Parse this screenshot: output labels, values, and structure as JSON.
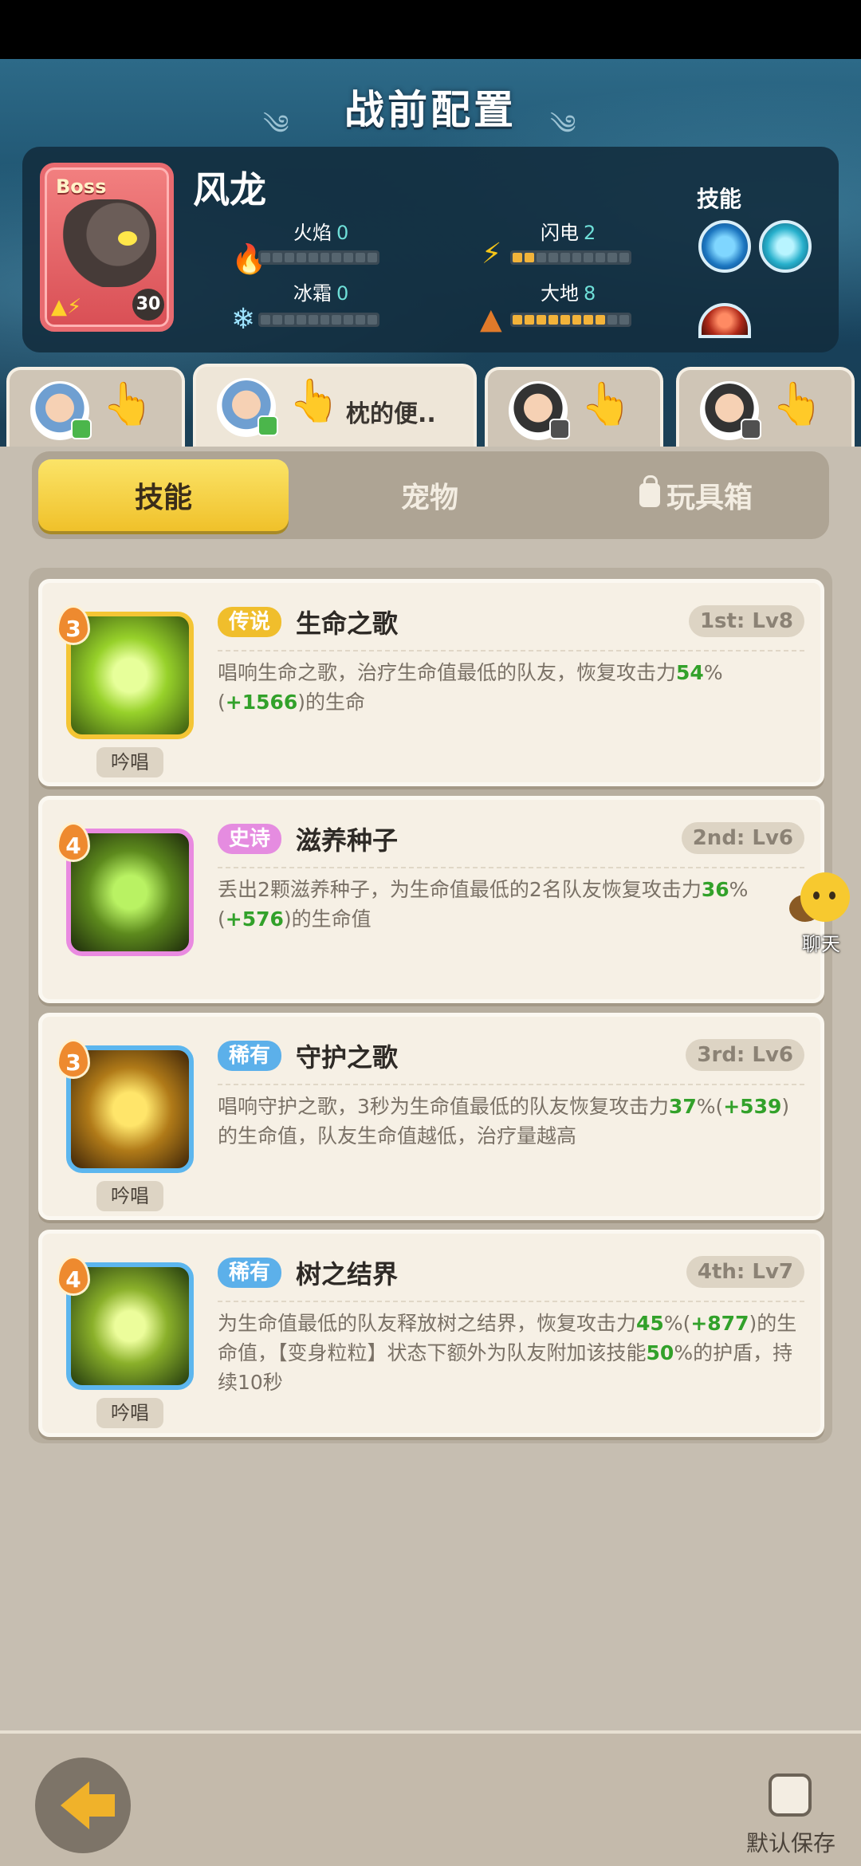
{
  "header": {
    "title": "战前配置"
  },
  "boss": {
    "tag": "Boss",
    "name": "风龙",
    "level": "30",
    "stats": [
      {
        "label": "火焰",
        "value": "0",
        "filled": 0
      },
      {
        "label": "闪电",
        "value": "2",
        "filled": 2
      },
      {
        "label": "冰霜",
        "value": "0",
        "filled": 0
      },
      {
        "label": "大地",
        "value": "8",
        "filled": 8
      }
    ],
    "skills_label": "技能"
  },
  "members": [
    {
      "name": ""
    },
    {
      "name": "枕的便.."
    },
    {
      "name": ""
    },
    {
      "name": ""
    }
  ],
  "tabs": {
    "skills": "技能",
    "pets": "宠物",
    "toybox": "玩具箱"
  },
  "skills": [
    {
      "cost": "3",
      "rarity": "传说",
      "name": "生命之歌",
      "slot": "1st: Lv8",
      "chant": "吟唱",
      "desc_pre": "唱响生命之歌，治疗生命值最低的队友，恢复攻击力",
      "desc_pct": "54",
      "desc_mid": "%(",
      "desc_add": "+1566",
      "desc_post": ")的生命"
    },
    {
      "cost": "4",
      "rarity": "史诗",
      "name": "滋养种子",
      "slot": "2nd: Lv6",
      "chant": "",
      "desc_pre": "丢出2颗滋养种子，为生命值最低的2名队友恢复攻击力",
      "desc_pct": "36",
      "desc_mid": "%(",
      "desc_add": "+576",
      "desc_post": ")的生命值"
    },
    {
      "cost": "3",
      "rarity": "稀有",
      "name": "守护之歌",
      "slot": "3rd: Lv6",
      "chant": "吟唱",
      "desc_pre": "唱响守护之歌，3秒为生命值最低的队友恢复攻击力",
      "desc_pct": "37",
      "desc_mid": "%(",
      "desc_add": "+539",
      "desc_post": ")的生命值，队友生命值越低，治疗量越高"
    },
    {
      "cost": "4",
      "rarity": "稀有",
      "name": "树之结界",
      "slot": "4th: Lv7",
      "chant": "吟唱",
      "desc_pre": "为生命值最低的队友释放树之结界，恢复攻击力",
      "desc_pct": "45",
      "desc_mid": "%(",
      "desc_add": "+877",
      "desc_post": ")的生命值，【变身粒粒】状态下额外为队友附加该技能",
      "desc_pct2": "50",
      "desc_tail": "%的护盾，持续10秒"
    }
  ],
  "chat": {
    "label": "聊天"
  },
  "bottom": {
    "save_label": "默认保存"
  }
}
